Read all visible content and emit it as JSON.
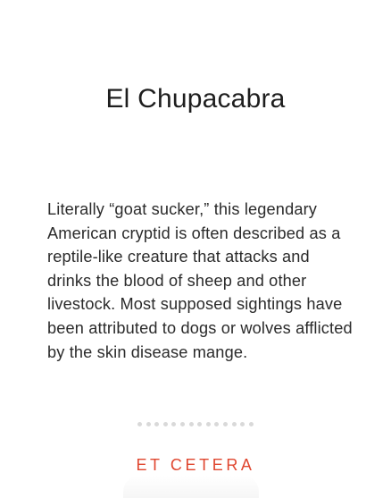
{
  "card": {
    "title": "El Chupacabra",
    "description": "Literally “goat sucker,” this legendary American cryptid is often described as a reptile-like creature that attacks and drinks the blood of sheep and other livestock. Most supposed sightings have been attributed to dogs or wolves afflicted by the skin disease mange.",
    "pagination": {
      "dot_count": 14,
      "dot_color": "#d9d9d9"
    },
    "brand": "ET CETERA",
    "brand_color": "#e0462f"
  }
}
